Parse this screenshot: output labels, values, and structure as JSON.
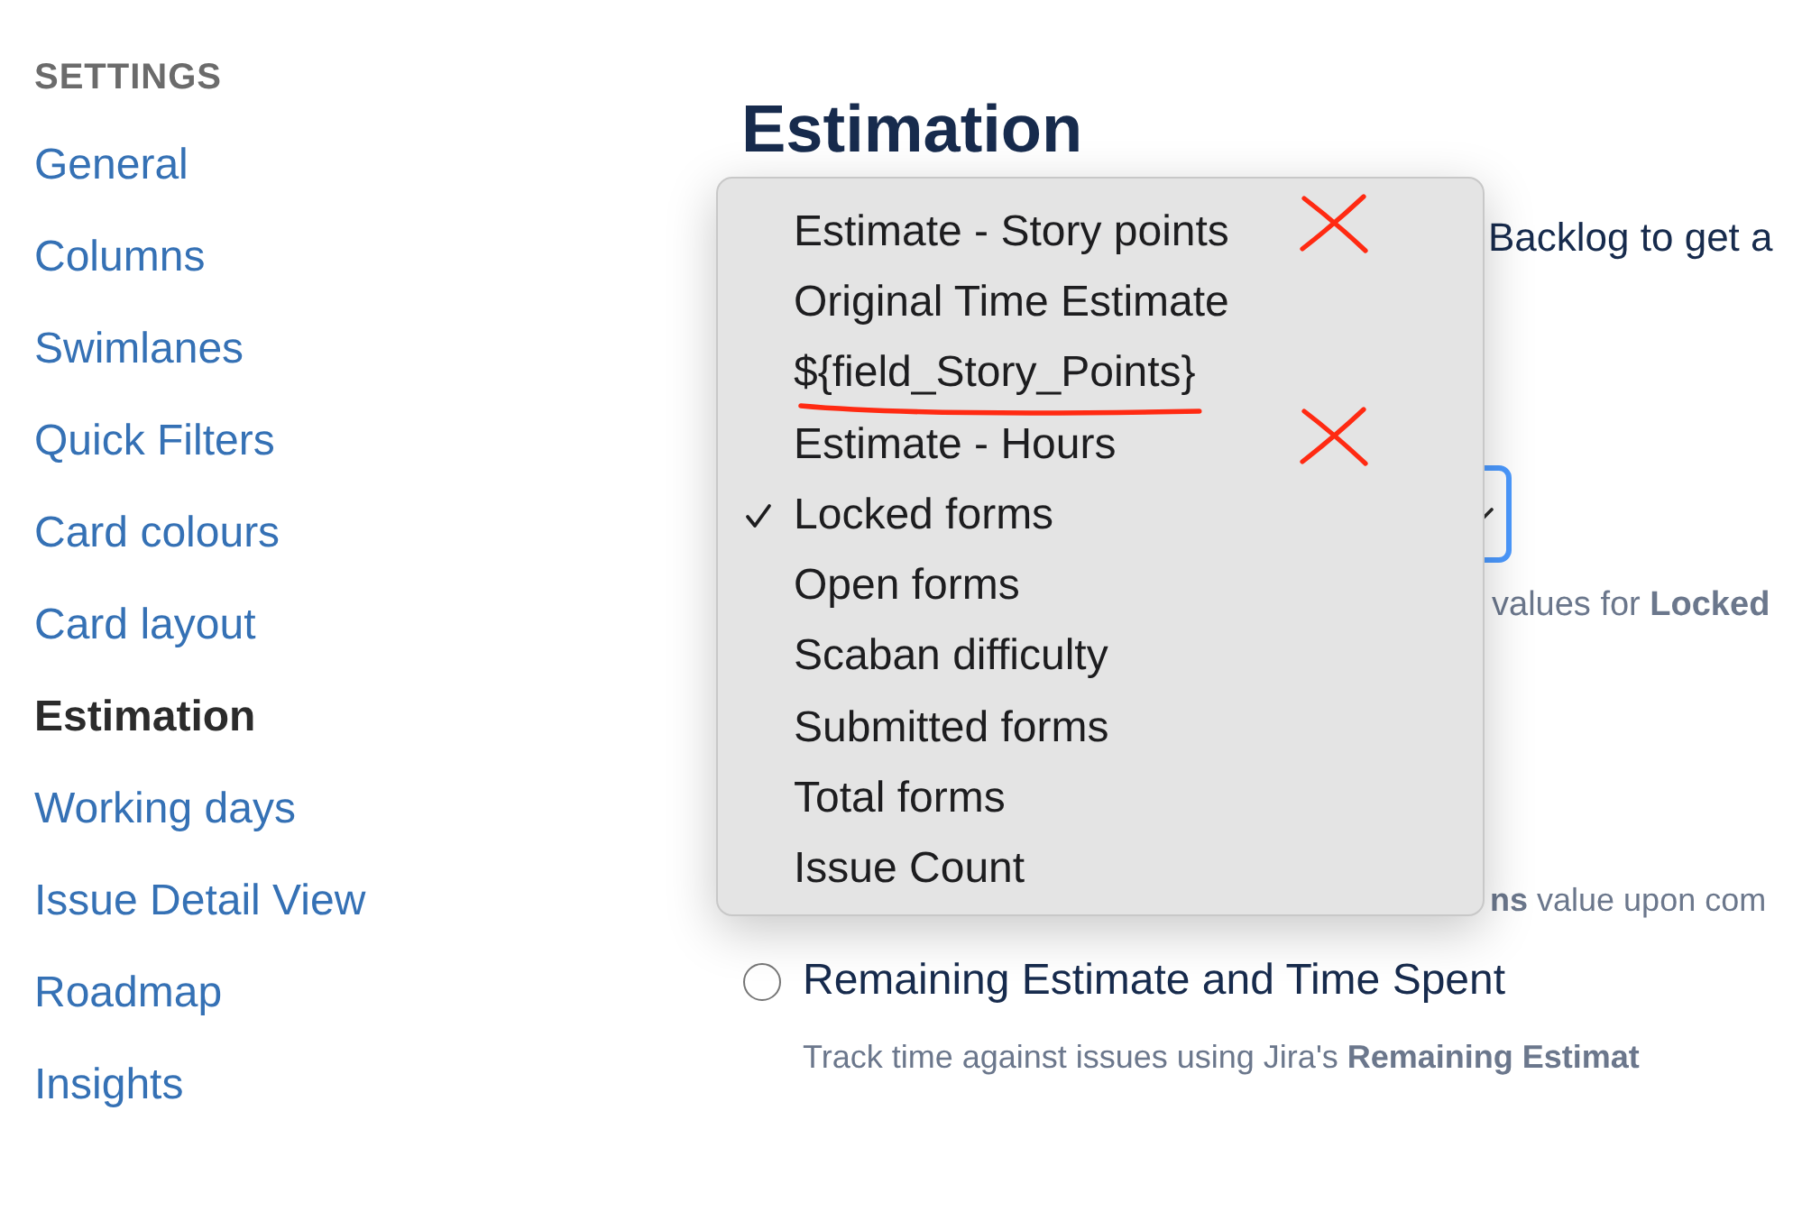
{
  "sidebar": {
    "heading": "SETTINGS",
    "items": [
      {
        "label": "General",
        "selected": false
      },
      {
        "label": "Columns",
        "selected": false
      },
      {
        "label": "Swimlanes",
        "selected": false
      },
      {
        "label": "Quick Filters",
        "selected": false
      },
      {
        "label": "Card colours",
        "selected": false
      },
      {
        "label": "Card layout",
        "selected": false
      },
      {
        "label": "Estimation",
        "selected": true
      },
      {
        "label": "Working days",
        "selected": false
      },
      {
        "label": "Issue Detail View",
        "selected": false
      },
      {
        "label": "Roadmap",
        "selected": false
      },
      {
        "label": "Insights",
        "selected": false
      }
    ]
  },
  "main": {
    "title": "Estimation",
    "intro_text": "Backlog to get a",
    "select": {
      "focused": true
    },
    "select_hint": "values for **Locked**",
    "option_hint": "**ns** value upon com",
    "radio_options": [
      {
        "label": "Remaining Estimate and Time Spent",
        "selected": false,
        "description": "Track time against issues using Jira's **Remaining Estimat**"
      }
    ]
  },
  "dropdown_menu": {
    "items": [
      {
        "label": "Estimate - Story points",
        "checked": false,
        "crossed_out": true,
        "underlined": false
      },
      {
        "label": "Original Time Estimate",
        "checked": false,
        "crossed_out": false,
        "underlined": false
      },
      {
        "label": "${field_Story_Points}",
        "checked": false,
        "crossed_out": false,
        "underlined": true
      },
      {
        "label": "Estimate - Hours",
        "checked": false,
        "crossed_out": true,
        "underlined": false
      },
      {
        "label": "Locked forms",
        "checked": true,
        "crossed_out": false,
        "underlined": false
      },
      {
        "label": "Open forms",
        "checked": false,
        "crossed_out": false,
        "underlined": false
      },
      {
        "label": "Scaban difficulty",
        "checked": false,
        "crossed_out": false,
        "underlined": false
      },
      {
        "label": "Submitted forms",
        "checked": false,
        "crossed_out": false,
        "underlined": false
      },
      {
        "label": "Total forms",
        "checked": false,
        "crossed_out": false,
        "underlined": false
      },
      {
        "label": "Issue Count",
        "checked": false,
        "crossed_out": false,
        "underlined": false
      }
    ]
  }
}
